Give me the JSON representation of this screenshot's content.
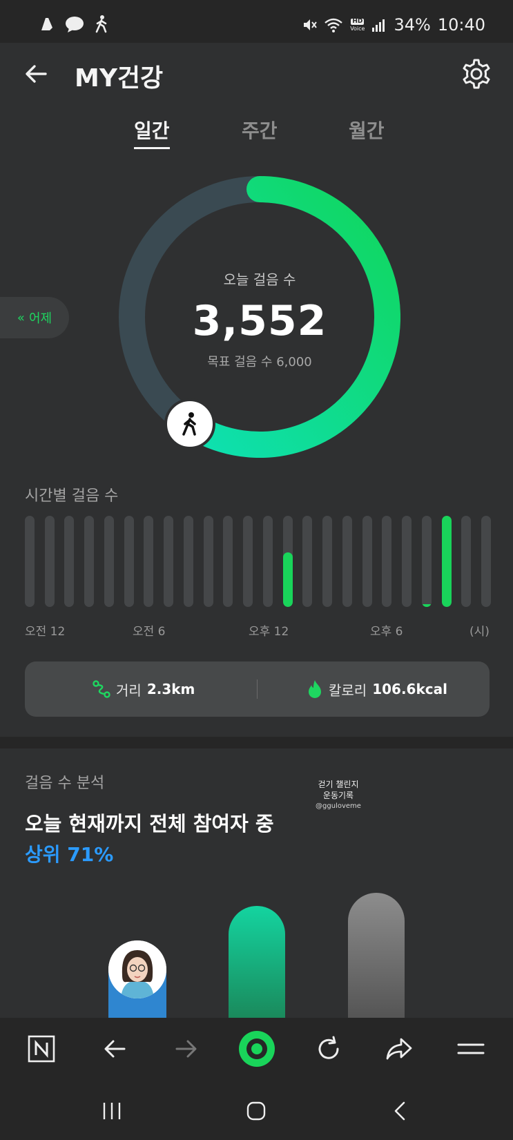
{
  "status_bar": {
    "battery": "34%",
    "time": "10:40",
    "hd_label": "HD",
    "voice_label": "Voice",
    "left_icons": [
      "notification-app-icon",
      "chat-bubble-icon",
      "walking-icon"
    ],
    "right_icons": [
      "mute-icon",
      "wifi-icon",
      "volte-icon",
      "signal-icon"
    ]
  },
  "header": {
    "title": "MY건강"
  },
  "tabs": [
    {
      "label": "일간",
      "active": true
    },
    {
      "label": "주간",
      "active": false
    },
    {
      "label": "월간",
      "active": false
    }
  ],
  "ring": {
    "label": "오늘 걸음 수",
    "count": "3,552",
    "goal_text": "목표 걸음 수 6,000",
    "progress": 0.592,
    "colors": {
      "track": "#3a4a52",
      "start": "#0ee0b2",
      "end": "#11d65c"
    }
  },
  "yesterday_button": {
    "label": "어제",
    "icon": "double-chevron-left-icon"
  },
  "hourly": {
    "title": "시간별 걸음 수",
    "levels": [
      0,
      0,
      0,
      0,
      0,
      0,
      0,
      0,
      0,
      0,
      0,
      0,
      0,
      0.6,
      0,
      0,
      0,
      0,
      0,
      0,
      0.03,
      1.0,
      0,
      0
    ],
    "axis_labels": [
      "오전 12",
      "오전 6",
      "오후 12",
      "오후 6",
      "(시)"
    ],
    "bar_color": "#19d45a"
  },
  "stats": {
    "distance_label": "거리",
    "distance_value": "2.3km",
    "calorie_label": "칼로리",
    "calorie_value": "106.6kcal"
  },
  "analysis": {
    "title": "걸음 수 분석",
    "main_text": "오늘 현재까지 전체 참여자 중",
    "rank_text": "상위 71%",
    "bars": [
      {
        "level": "me",
        "color": "#2f86d0"
      },
      {
        "level": "average",
        "color": "#14c79a"
      },
      {
        "level": "top",
        "color": "#8a8a8a"
      }
    ]
  },
  "watermark": {
    "line1": "걷기 챌린지",
    "line2": "운동기록",
    "line3": "@ggulovemе"
  },
  "browser_bar": {
    "icons": [
      "naver-n-icon",
      "back-arrow-icon",
      "forward-arrow-icon",
      "green-dot-home-icon",
      "refresh-icon",
      "share-icon",
      "menu-icon"
    ]
  },
  "nav_bar": {
    "icons": [
      "recent-apps-icon",
      "home-icon",
      "back-icon"
    ]
  }
}
